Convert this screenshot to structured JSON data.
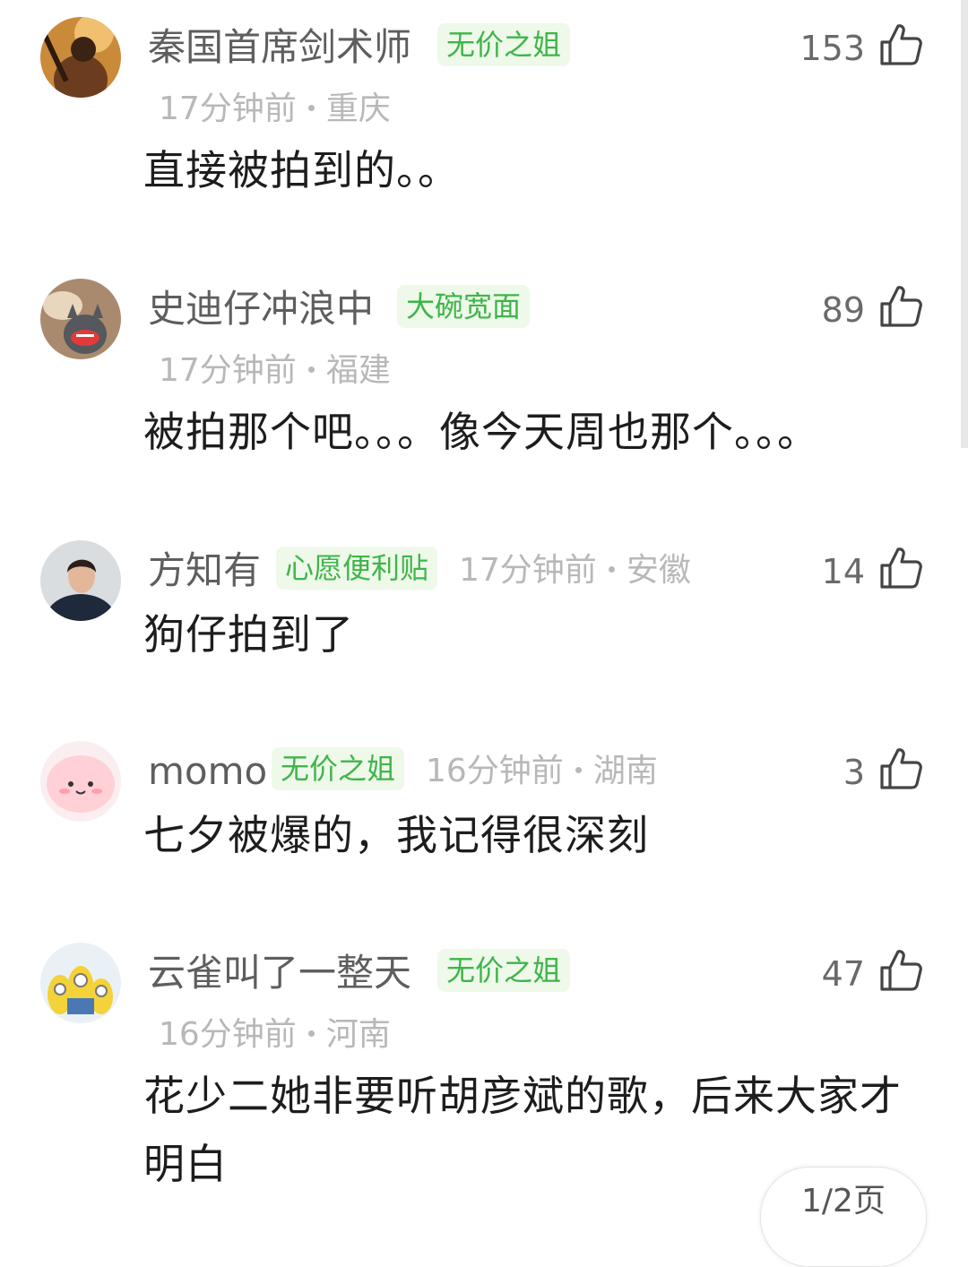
{
  "comments": [
    {
      "username": "秦国首席剑术师",
      "badge": "无价之姐",
      "time": "17分钟前",
      "location": "重庆",
      "likes": "153",
      "text": "直接被拍到的。。",
      "avatar": "warrior-avatar"
    },
    {
      "username": "史迪仔冲浪中",
      "badge": "大碗宽面",
      "time": "17分钟前",
      "location": "福建",
      "likes": "89",
      "text": "被拍那个吧。。。像今天周也那个。。。",
      "avatar": "plush-toy-avatar"
    },
    {
      "username": "方知有",
      "badge": "心愿便利贴",
      "time": "17分钟前",
      "location": "安徽",
      "likes": "14",
      "text": "狗仔拍到了",
      "avatar": "man-photo-avatar"
    },
    {
      "username": "momo",
      "badge": "无价之姐",
      "time": "16分钟前",
      "location": "湖南",
      "likes": "3",
      "text": "七夕被爆的，我记得很深刻",
      "avatar": "pink-cartoon-avatar"
    },
    {
      "username": "云雀叫了一整天",
      "badge": "无价之姐",
      "time": "16分钟前",
      "location": "河南",
      "likes": "47",
      "text": "花少二她非要听胡彦斌的歌，后来大家才明白",
      "avatar": "minions-avatar"
    }
  ],
  "pager": {
    "label": "1/2页"
  },
  "colors": {
    "badge_bg": "#eef9ea",
    "badge_text": "#3fb549",
    "username": "#5e5e5e",
    "meta": "#b8b8b8",
    "content": "#1d1d1d"
  }
}
